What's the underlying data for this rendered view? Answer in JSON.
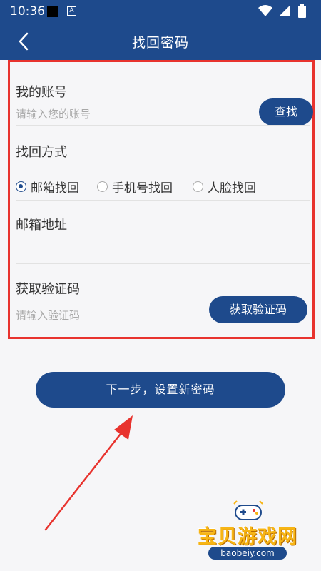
{
  "status_bar": {
    "time": "10:36",
    "notification_badge": "A"
  },
  "app_bar": {
    "title": "找回密码",
    "back_icon": "chevron-left-icon"
  },
  "form": {
    "account": {
      "label": "我的账号",
      "placeholder": "请输入您的账号",
      "search_button": "查找"
    },
    "method": {
      "label": "找回方式",
      "options": [
        {
          "label": "邮箱找回",
          "checked": true
        },
        {
          "label": "手机号找回",
          "checked": false
        },
        {
          "label": "人脸找回",
          "checked": false
        }
      ]
    },
    "email": {
      "label": "邮箱地址",
      "value": ""
    },
    "code": {
      "label": "获取验证码",
      "placeholder": "请输入验证码",
      "get_code_button": "获取验证码"
    }
  },
  "next_button": "下一步，设置新密码",
  "watermark": {
    "name": "宝贝游戏网",
    "url": "baobeiy.com"
  },
  "colors": {
    "primary": "#1e4a8c",
    "highlight": "#e8332e",
    "background": "#f6f6f8"
  }
}
